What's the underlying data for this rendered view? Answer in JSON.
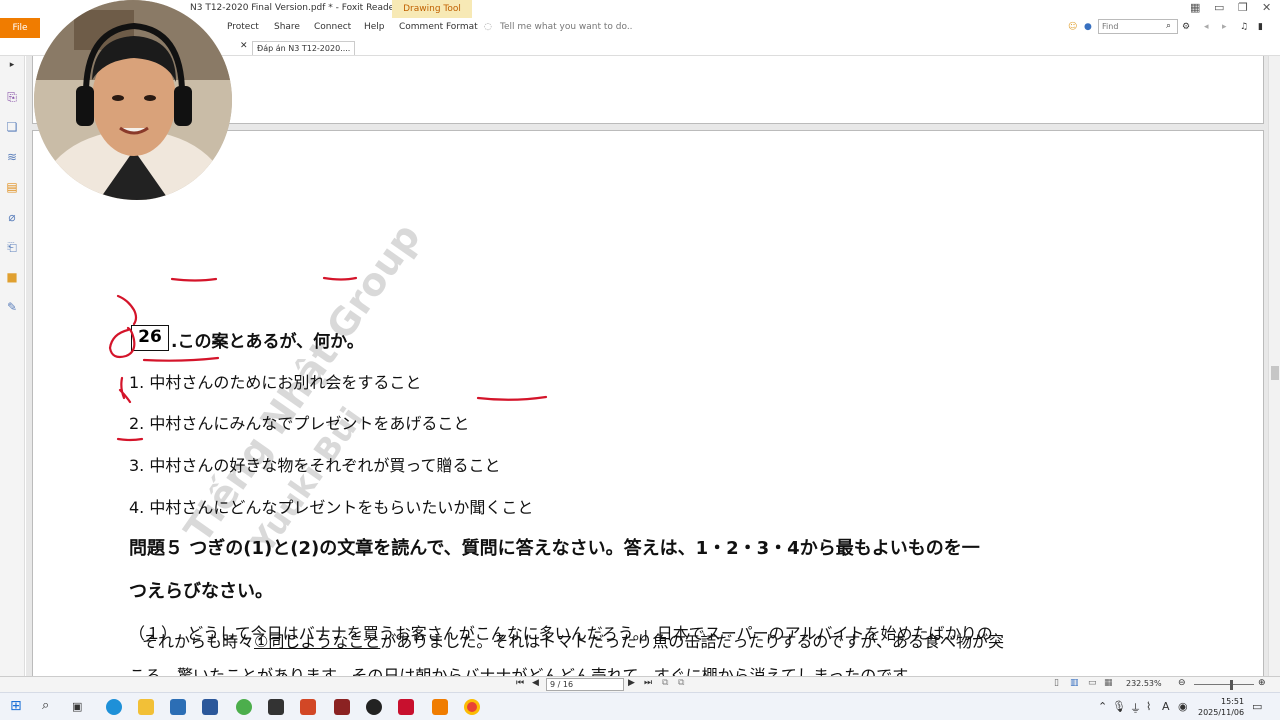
{
  "titlebar": {
    "title": "N3 T12-2020 Final Version.pdf * - Foxit Reader",
    "drawing_tool": "Drawing Tool"
  },
  "ribbon": {
    "file": "File",
    "menus": [
      "Protect",
      "Share",
      "Connect",
      "Help",
      "Comment Format"
    ],
    "tell_me": "Tell me what you want to do..",
    "find_placeholder": "Find"
  },
  "tabs": {
    "doc_tab": "Đáp án N3 T12-2020...."
  },
  "document": {
    "question_number": "26",
    "question_prefix": ".",
    "question_underlined_1": "この案",
    "question_mid": "とあるが、",
    "question_underlined_2": "何か",
    "question_end": "。",
    "options": [
      {
        "num": "1.",
        "text": "中村さんのためにお別れ会をすること"
      },
      {
        "num": "2.",
        "text": "中村さんにみんなでプレゼントをあげること"
      },
      {
        "num": "3.",
        "text": "中村さんの好きな物をそれぞれが買って贈ること"
      },
      {
        "num": "4.",
        "text": "中村さんにどんなプレゼントをもらいたいか聞くこと"
      }
    ],
    "section_title_line1": "問題５ つぎの(1)と(2)の文章を読んで、質問に答えなさい。答えは、1・2・3・4から最もよいものを一",
    "section_title_line2": "つえらびなさい。",
    "para1_line1": "（１）. どうして今日はバナナを買うお客さんがこんなに多いんだろう。」日本でスーパーのアルバイトを始めたばかりの",
    "para1_line2": "ころ、驚いたことがあります。その日は朝からバナナがどんどん売れて、すぐに棚から消えてしまったのです。",
    "para2_prefix": "それからも時々",
    "para2_underlined": "①同じようなこと",
    "para2_rest": "がありました。それはトマトだったり魚の缶詰だったりするのですが、ある食べ物が突",
    "watermark_1": "Tiếng Nhật Group",
    "watermark_2": "Yuuki Bùi"
  },
  "statusbar": {
    "page_indicator": "9 / 16",
    "zoom": "232.53%"
  },
  "taskbar": {
    "time": "15:51",
    "date": "2025/11/06"
  },
  "colors": {
    "accent_orange": "#f07c00",
    "annotation_red": "#d4142a"
  }
}
